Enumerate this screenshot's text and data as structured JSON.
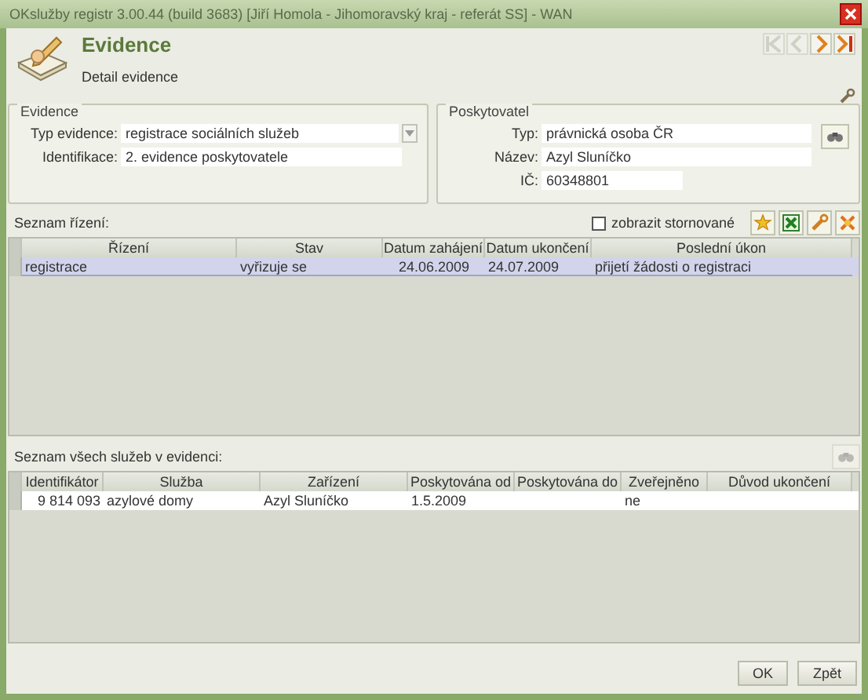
{
  "window": {
    "title": "OKslužby registr 3.00.44 (build 3683)  [Jiří Homola - Jihomoravský kraj - referát SS] - WAN"
  },
  "header": {
    "title": "Evidence",
    "subtitle": "Detail evidence"
  },
  "nav_buttons": [
    {
      "kind": "first",
      "disabled": true
    },
    {
      "kind": "prev",
      "disabled": true
    },
    {
      "kind": "next",
      "disabled": false
    },
    {
      "kind": "last",
      "disabled": false
    }
  ],
  "evidence": {
    "legend": "Evidence",
    "fields": [
      {
        "kind": "dropdown",
        "label": "Typ evidence:",
        "value": "registrace sociálních služeb"
      },
      {
        "kind": "text",
        "label": "Identifikace:",
        "value": "2. evidence poskytovatele"
      }
    ]
  },
  "provider": {
    "legend": "Poskytovatel",
    "fields": [
      {
        "label": "Typ:",
        "value": "právnická osoba ČR"
      },
      {
        "label": "Název:",
        "value": "Azyl Sluníčko"
      },
      {
        "label": "IČ:",
        "value": "60348801"
      }
    ]
  },
  "proceedings": {
    "label": "Seznam řízení:",
    "show_cancelled": {
      "label": "zobrazit stornované",
      "checked": false
    },
    "toolbar": [
      {
        "kind": "new"
      },
      {
        "kind": "export"
      },
      {
        "kind": "edit"
      },
      {
        "kind": "cancel"
      }
    ],
    "columns": [
      "Řízení",
      "Stav",
      "Datum zahájení",
      "Datum ukončení",
      "Poslední úkon"
    ],
    "rows": [
      {
        "selected": true,
        "cells": [
          "registrace",
          "vyřizuje se",
          "24.06.2009",
          "24.07.2009",
          "přijetí žádosti o registraci"
        ]
      }
    ]
  },
  "services": {
    "label": "Seznam všech služeb v evidenci:",
    "columns": [
      "Identifikátor",
      "Služba",
      "Zařízení",
      "Poskytována od",
      "Poskytována do",
      "Zveřejněno",
      "Důvod ukončení"
    ],
    "rows": [
      {
        "selected": false,
        "cells": [
          "9 814 093",
          "azylové domy",
          "Azyl Sluníčko",
          "1.5.2009",
          "",
          "ne",
          ""
        ]
      }
    ]
  },
  "buttons": [
    "OK",
    "Zpět"
  ]
}
